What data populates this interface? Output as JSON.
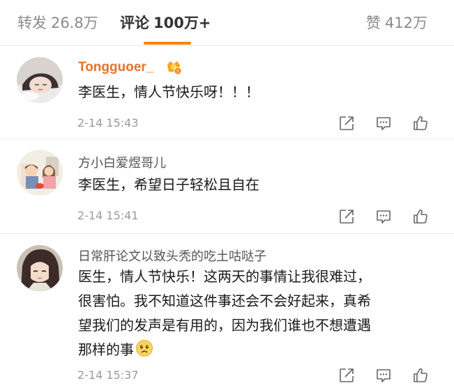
{
  "tabs": {
    "repost": {
      "label": "转发",
      "count": "26.8万"
    },
    "comment": {
      "label": "评论",
      "count": "100万+"
    },
    "like": {
      "label": "赞",
      "count": "412万"
    }
  },
  "comments": [
    {
      "username": "Tongguoer_",
      "lines": [
        "李医生，情人节快乐呀！！！"
      ],
      "time": "2-14 15:43"
    },
    {
      "username": "方小白爱煜哥儿",
      "lines": [
        "李医生，希望日子轻松且自在"
      ],
      "time": "2-14 15:41"
    },
    {
      "username": "日常肝论文以致头秃的吃土咕哒子",
      "lines": [
        "医生，情人节快乐！这两天的事情让我很难过，",
        "很害怕。我不知道这件事还会不会好起来，真希",
        "望我们的发声是有用的，因为我们谁也不想遭遇",
        "那样的事"
      ],
      "time": "2-14 15:37"
    }
  ],
  "colors": {
    "accent": "#ff8200",
    "username_vip": "#e7732a",
    "muted": "#9a9a9a"
  },
  "icons": {
    "share": "share-icon",
    "comment": "comment-icon",
    "like": "thumbs-up-icon",
    "emoji": "sad-face-emoji"
  }
}
